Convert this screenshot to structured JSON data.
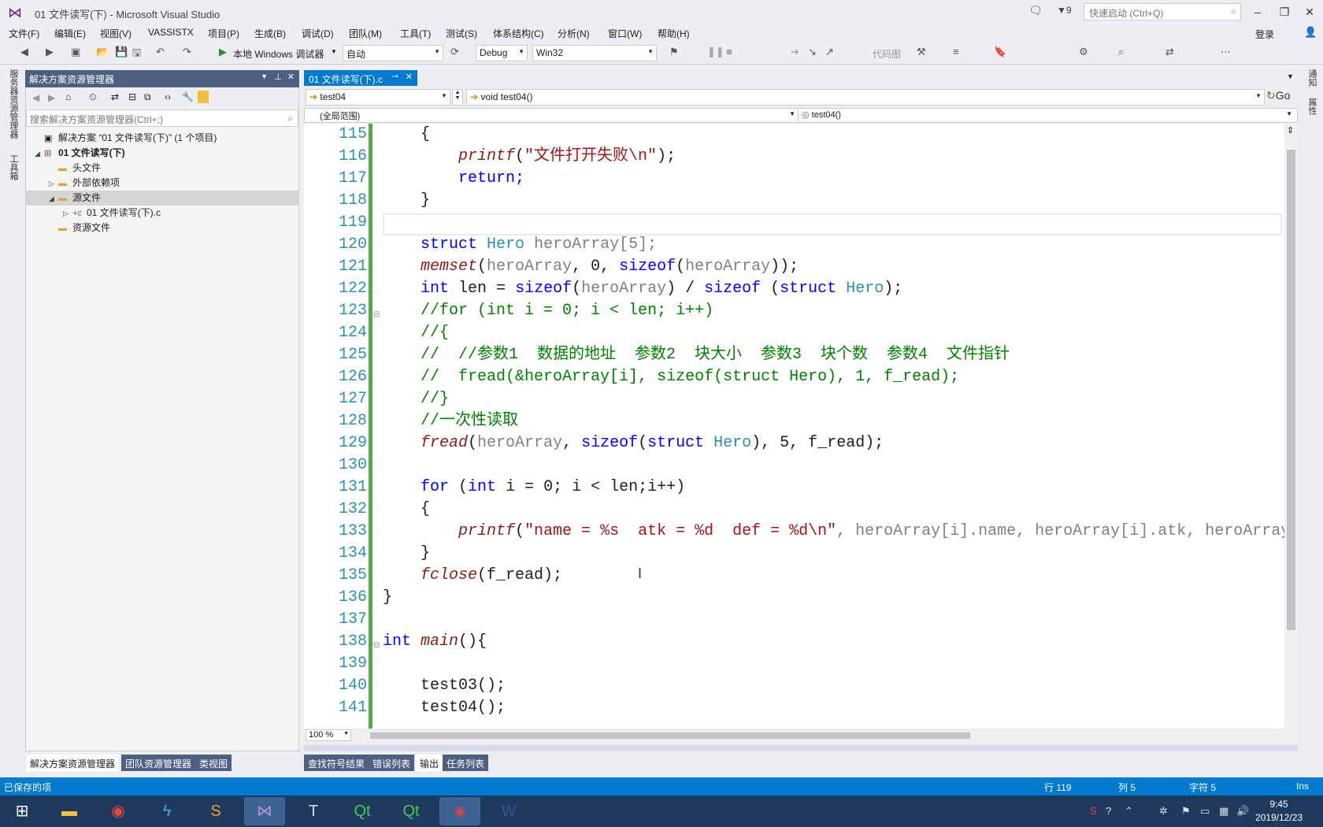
{
  "window": {
    "title": "01 文件读写(下) - Microsoft Visual Studio",
    "notifications_count": "9",
    "quick_launch_placeholder": "快速启动 (Ctrl+Q)"
  },
  "menu": [
    "文件(F)",
    "编辑(E)",
    "视图(V)",
    "VASSISTX",
    "项目(P)",
    "生成(B)",
    "调试(D)",
    "团队(M)",
    "工具(T)",
    "测试(S)",
    "体系结构(C)",
    "分析(N)",
    "窗口(W)",
    "帮助(H)"
  ],
  "login_label": "登录",
  "toolbar": {
    "debugger_label": "本地 Windows 调试器",
    "auto_value": "自动",
    "config_value": "Debug",
    "platform_value": "Win32",
    "code_map_label": "代码图"
  },
  "left_rail": {
    "server_explorer": "服务器资源管理器",
    "toolbox": "工具箱"
  },
  "right_rail": {
    "notifications": "通知",
    "properties": "属性"
  },
  "solution_explorer": {
    "title": "解决方案资源管理器",
    "search_placeholder": "搜索解决方案资源管理器(Ctrl+;)",
    "items": [
      {
        "label": "解决方案 “01 文件读写(下)” (1 个项目)",
        "icon": "solution-icon"
      },
      {
        "label": "01 文件读写(下)",
        "icon": "project-icon"
      },
      {
        "label": "头文件",
        "icon": "folder-icon"
      },
      {
        "label": "外部依赖项",
        "icon": "folder-icon"
      },
      {
        "label": "源文件",
        "icon": "folder-icon"
      },
      {
        "label": "01 文件读写(下).c",
        "icon": "c-file-icon"
      },
      {
        "label": "资源文件",
        "icon": "folder-icon"
      }
    ],
    "bottom_tabs": [
      "解决方案资源管理器",
      "团队资源管理器",
      "类视图"
    ]
  },
  "editor": {
    "tab_label": "01 文件读写(下).c",
    "nav_left": "test04",
    "nav_right": "void test04()",
    "go_label": "Go",
    "scope_left": "(全局范围)",
    "scope_right": "test04()",
    "zoom": "100 %",
    "line_numbers": [
      "115",
      "116",
      "117",
      "118",
      "119",
      "120",
      "121",
      "122",
      "123",
      "124",
      "125",
      "126",
      "127",
      "128",
      "129",
      "130",
      "131",
      "132",
      "133",
      "134",
      "135",
      "136",
      "137",
      "138",
      "139",
      "140",
      "141"
    ],
    "code": {
      "l115": "{",
      "l116_fn": "printf",
      "l116_str": "\"文件打开失败\\n\"",
      "l117": "return;",
      "l118": "}",
      "l120_kw": "struct",
      "l120_ty": "Hero",
      "l120_rest": "heroArray[5];",
      "l121_fn": "memset",
      "l121_a": "heroArray",
      "l121_b": ", 0, ",
      "l121_kw": "sizeof",
      "l121_c": "heroArray",
      "l122_kw": "int",
      "l122_a": "len = ",
      "l122_kw2": "sizeof",
      "l122_b": "heroArray",
      "l122_c": ") / ",
      "l122_kw3": "sizeof",
      "l122_kw4": "struct",
      "l122_ty": "Hero",
      "l123": "//for (int i = 0; i < len; i++)",
      "l124": "//{",
      "l125": "//  //参数1  数据的地址  参数2  块大小  参数3  块个数  参数4  文件指针",
      "l126": "//  fread(&heroArray[i], sizeof(struct Hero), 1, f_read);",
      "l127": "//}",
      "l128": "//一次性读取",
      "l129_fn": "fread",
      "l129_a": "heroArray",
      "l129_kw": "sizeof",
      "l129_kw2": "struct",
      "l129_ty": "Hero",
      "l129_b": "), 5, f_read);",
      "l131_kw": "for",
      "l131_kw2": "int",
      "l131_a": "i = 0; i < len;i++)",
      "l132": "{",
      "l133_fn": "printf",
      "l133_str": "\"name = %s  atk = %d  def = %d\\n\"",
      "l133_a": ", heroArray[i].name, heroArray[i].atk, heroArray",
      "l134": "}",
      "l135_fn": "fclose",
      "l135_a": "(f_read);",
      "l136": "}",
      "l138_kw": "int",
      "l138_fn": "main",
      "l138_a": "(){",
      "l140": "test03();",
      "l141": "test04();"
    },
    "bottom_tabs": [
      "查找符号结果",
      "错误列表",
      "输出",
      "任务列表"
    ]
  },
  "status": {
    "message": "已保存的项",
    "row": "行 119",
    "col": "列 5",
    "char": "字符 5",
    "mode": "Ins"
  },
  "taskbar": {
    "time": "9:45",
    "date": "2019/12/23",
    "apps": [
      "windows-start",
      "file-explorer",
      "chrome",
      "thunder",
      "sublime",
      "visual-studio",
      "typora",
      "qt-creator",
      "qt-designer",
      "network-app",
      "word"
    ]
  }
}
